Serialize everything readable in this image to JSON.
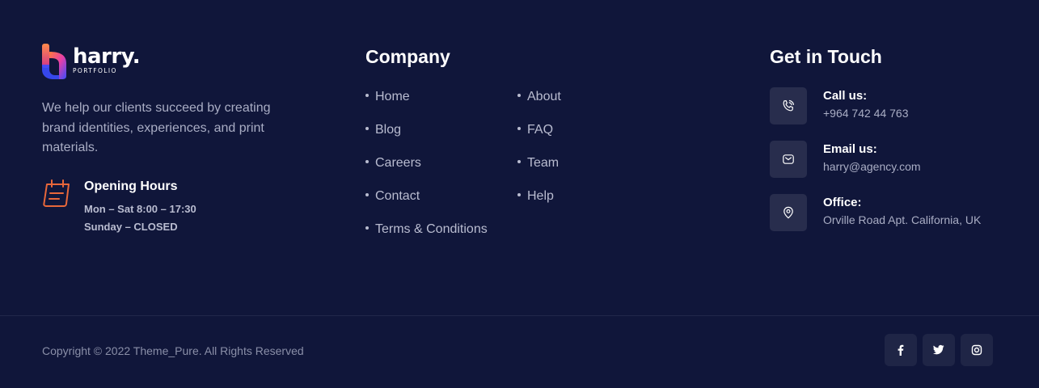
{
  "brand": {
    "name": "harry.",
    "tagline": "PORTFOLIO",
    "description": "We help our clients succeed by creating brand identities, experiences, and print materials.",
    "hours": {
      "title": "Opening Hours",
      "lines": [
        "Mon – Sat 8:00 – 17:30",
        "Sunday – CLOSED"
      ]
    },
    "accent_gradient": [
      "#ff6a3d",
      "#c13ee0",
      "#3b4dff"
    ]
  },
  "company": {
    "title": "Company",
    "left_links": [
      "Home",
      "Blog",
      "Careers",
      "Contact",
      "Terms & Conditions"
    ],
    "right_links": [
      "About",
      "FAQ",
      "Team",
      "Help"
    ]
  },
  "contact": {
    "title": "Get in Touch",
    "items": [
      {
        "label": "Call us:",
        "value": "+964 742 44 763",
        "icon": "phone-icon"
      },
      {
        "label": "Email us:",
        "value": "harry@agency.com",
        "icon": "mail-icon"
      },
      {
        "label": "Office:",
        "value": "Orville Road Apt. California, UK",
        "icon": "location-pin-icon"
      }
    ]
  },
  "bottom": {
    "copyright": "Copyright © 2022 Theme_Pure. All Rights Reserved",
    "socials": [
      "facebook-icon",
      "twitter-icon",
      "instagram-icon"
    ]
  },
  "colors": {
    "background": "#10163a",
    "icon_box": "#282d4d",
    "hours_icon": "#e8673a"
  }
}
